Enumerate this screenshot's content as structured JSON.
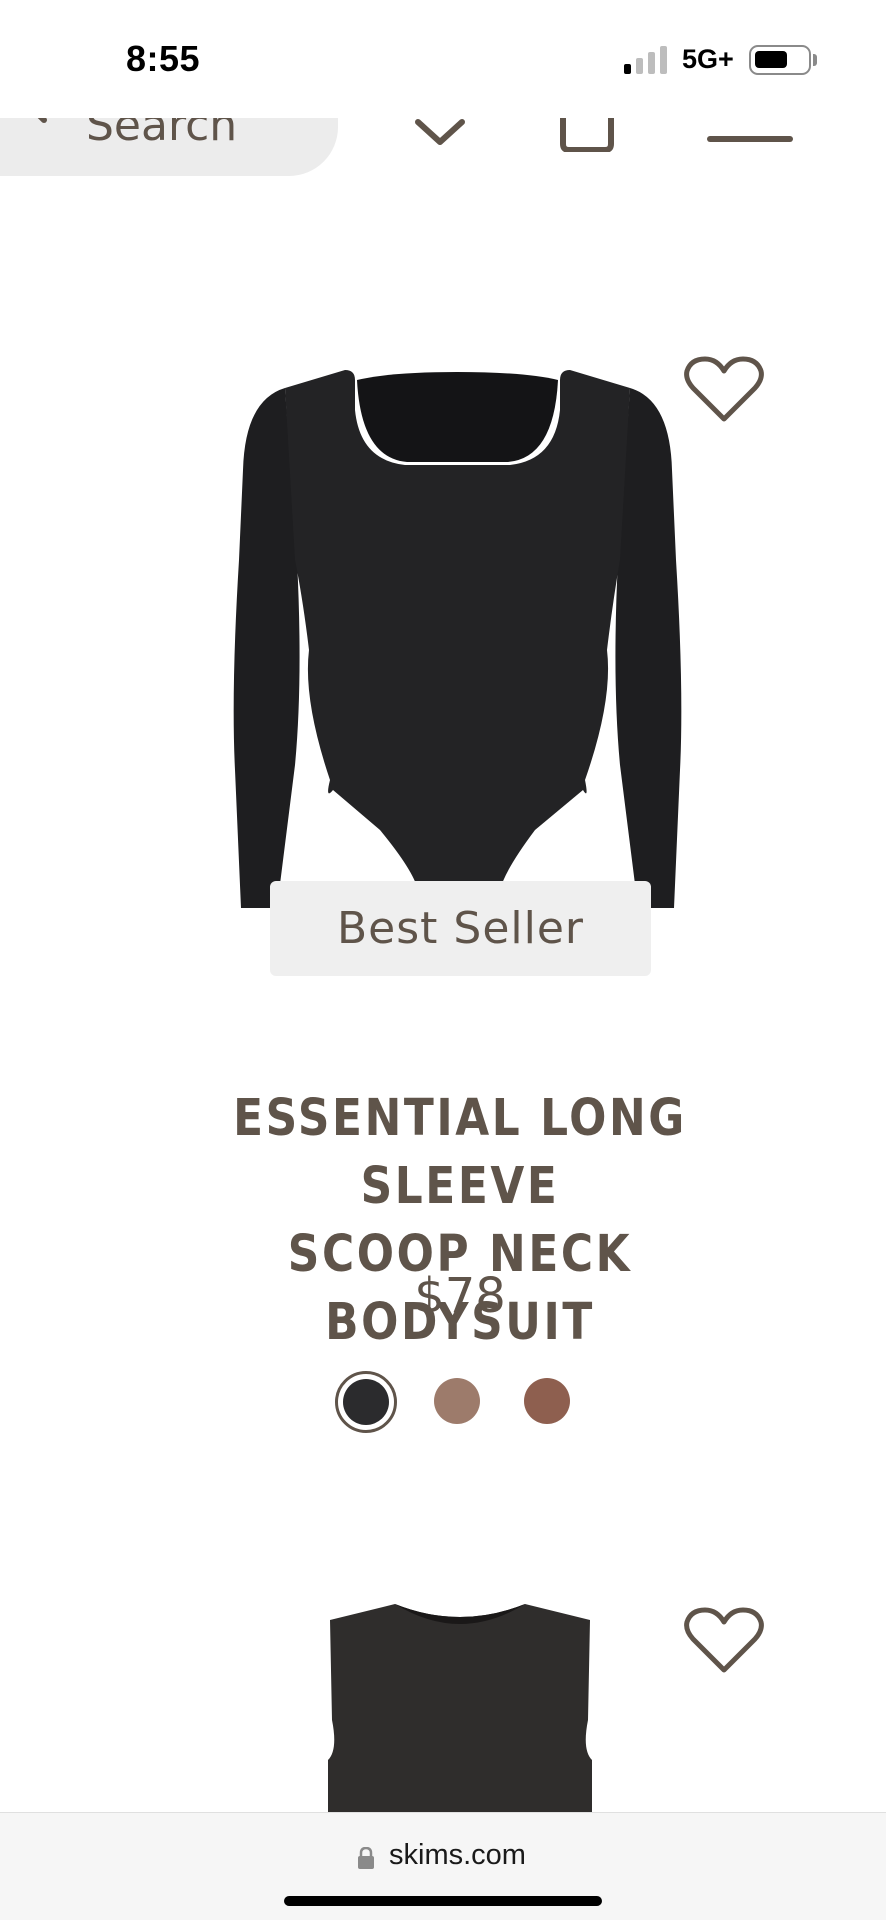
{
  "status_bar": {
    "time": "8:55",
    "network": "5G+"
  },
  "header": {
    "search_placeholder": "Search"
  },
  "products": [
    {
      "badge": "Best Seller",
      "title_line1": "ESSENTIAL LONG SLEEVE",
      "title_line2": "SCOOP NECK BODYSUIT",
      "price": "$78",
      "swatches": [
        "#2b2b2d",
        "#9d7b6b",
        "#8e5f4f"
      ],
      "selected_swatch": 0
    }
  ],
  "url_bar": {
    "domain": "skims.com"
  },
  "colors": {
    "brand_text": "#5f544a",
    "badge_bg": "#efefef",
    "search_bg": "#ececec"
  }
}
